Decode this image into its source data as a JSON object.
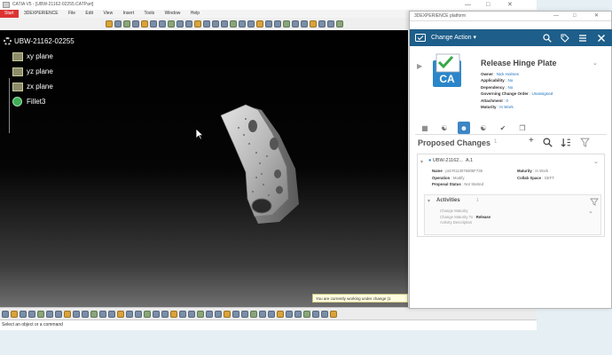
{
  "window": {
    "title": "CATIA V5 - [UBW-21162-02255.CATPart]",
    "controls": [
      "—",
      "□",
      "✕"
    ]
  },
  "menu": {
    "items": [
      "Start",
      "3DEXPERIENCE",
      "File",
      "Edit",
      "View",
      "Insert",
      "Tools",
      "Window",
      "Help"
    ],
    "active": "Start"
  },
  "tree": {
    "root": "UBW-21162-02255",
    "planes": [
      "xy plane",
      "yz plane",
      "zx plane"
    ],
    "feature": "Fillet3"
  },
  "status": {
    "message": "Select an object or a command",
    "tooltip": "You are currently working under change (1"
  },
  "panel": {
    "window_title": "3DEXPERIENCE platform",
    "controls": [
      "—",
      "□",
      "✕"
    ],
    "header_label": "Change Action",
    "header_icons": [
      "search-icon",
      "tag-icon",
      "menu-icon",
      "close-icon"
    ],
    "icon_text": "CA",
    "title": "Release Hinge Plate",
    "properties": [
      {
        "label": "Owner",
        "value": "Nick Holmes",
        "link": true
      },
      {
        "label": "Applicability",
        "value": "No",
        "link": true
      },
      {
        "label": "Dependency",
        "value": "No",
        "link": true
      },
      {
        "label": "Governing Change Order",
        "value": "Unassigned",
        "link": true
      },
      {
        "label": "Attachment",
        "value": "0",
        "link": true
      },
      {
        "label": "Maturity",
        "value": "In Work",
        "link": true
      }
    ],
    "tabs": [
      "attributes-icon",
      "members-icon",
      "person-icon",
      "tree-icon",
      "check-icon",
      "copy-icon"
    ],
    "active_tab": 2,
    "proposed": {
      "title": "Proposed Changes",
      "count": "1",
      "item_name": "UBW-21162...",
      "item_rev": "A.1",
      "name_label": "Name",
      "name_value": "prd-R113076805F735",
      "maturity_label": "Maturity",
      "maturity_value": "In Work",
      "operation_label": "Operation",
      "operation_value": "Modify",
      "collab_label": "Collab Space",
      "collab_value": "GEFT",
      "proposal_label": "Proposal Status",
      "proposal_value": "Not Started"
    },
    "activities": {
      "title": "Activities",
      "count": "1",
      "lines": [
        "Change Maturity",
        "Change Maturity To",
        "Release",
        "Activity Description"
      ]
    }
  }
}
